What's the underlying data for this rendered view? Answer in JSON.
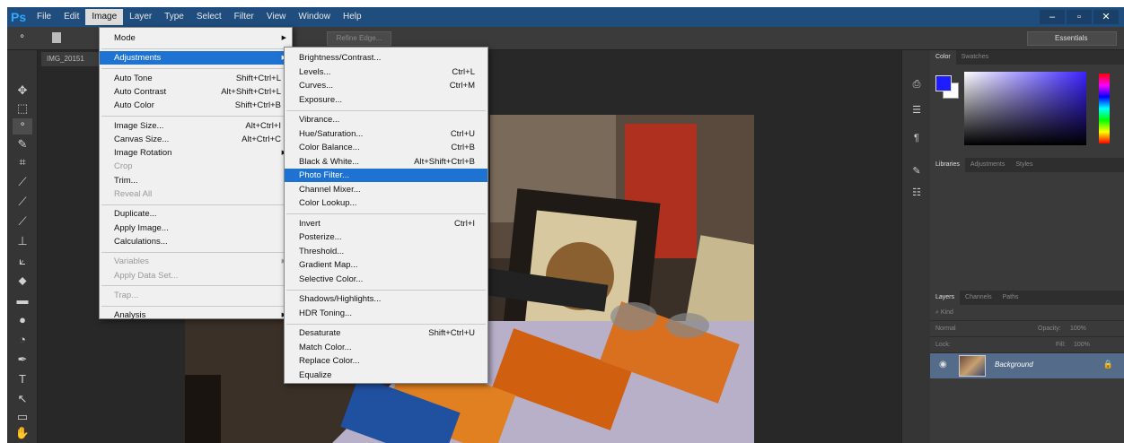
{
  "app": {
    "logo": "Ps",
    "window_controls": [
      "–",
      "▫",
      "✕"
    ]
  },
  "menubar": {
    "items": [
      "File",
      "Edit",
      "Image",
      "Layer",
      "Type",
      "Select",
      "Filter",
      "View",
      "Window",
      "Help"
    ],
    "active": "Image"
  },
  "options": {
    "refine_edge": "Refine Edge...",
    "workspace": "Essentials"
  },
  "document": {
    "tab": "IMG_20151"
  },
  "image_menu": [
    {
      "label": "Mode",
      "submenu": true
    },
    {
      "sep": true
    },
    {
      "label": "Adjustments",
      "submenu": true,
      "highlight": true
    },
    {
      "sep": true
    },
    {
      "label": "Auto Tone",
      "shortcut": "Shift+Ctrl+L"
    },
    {
      "label": "Auto Contrast",
      "shortcut": "Alt+Shift+Ctrl+L"
    },
    {
      "label": "Auto Color",
      "shortcut": "Shift+Ctrl+B"
    },
    {
      "sep": true
    },
    {
      "label": "Image Size...",
      "shortcut": "Alt+Ctrl+I"
    },
    {
      "label": "Canvas Size...",
      "shortcut": "Alt+Ctrl+C"
    },
    {
      "label": "Image Rotation",
      "submenu": true
    },
    {
      "label": "Crop",
      "disabled": true
    },
    {
      "label": "Trim..."
    },
    {
      "label": "Reveal All",
      "disabled": true
    },
    {
      "sep": true
    },
    {
      "label": "Duplicate..."
    },
    {
      "label": "Apply Image..."
    },
    {
      "label": "Calculations..."
    },
    {
      "sep": true
    },
    {
      "label": "Variables",
      "submenu": true,
      "disabled": true
    },
    {
      "label": "Apply Data Set...",
      "disabled": true
    },
    {
      "sep": true
    },
    {
      "label": "Trap...",
      "disabled": true
    },
    {
      "sep": true
    },
    {
      "label": "Analysis",
      "submenu": true
    }
  ],
  "adjustments_menu": [
    {
      "label": "Brightness/Contrast..."
    },
    {
      "label": "Levels...",
      "shortcut": "Ctrl+L"
    },
    {
      "label": "Curves...",
      "shortcut": "Ctrl+M"
    },
    {
      "label": "Exposure..."
    },
    {
      "sep": true
    },
    {
      "label": "Vibrance..."
    },
    {
      "label": "Hue/Saturation...",
      "shortcut": "Ctrl+U"
    },
    {
      "label": "Color Balance...",
      "shortcut": "Ctrl+B"
    },
    {
      "label": "Black & White...",
      "shortcut": "Alt+Shift+Ctrl+B"
    },
    {
      "label": "Photo Filter...",
      "highlight": true
    },
    {
      "label": "Channel Mixer..."
    },
    {
      "label": "Color Lookup..."
    },
    {
      "sep": true
    },
    {
      "label": "Invert",
      "shortcut": "Ctrl+I"
    },
    {
      "label": "Posterize..."
    },
    {
      "label": "Threshold..."
    },
    {
      "label": "Gradient Map..."
    },
    {
      "label": "Selective Color..."
    },
    {
      "sep": true
    },
    {
      "label": "Shadows/Highlights..."
    },
    {
      "label": "HDR Toning..."
    },
    {
      "sep": true
    },
    {
      "label": "Desaturate",
      "shortcut": "Shift+Ctrl+U"
    },
    {
      "label": "Match Color..."
    },
    {
      "label": "Replace Color..."
    },
    {
      "label": "Equalize"
    }
  ],
  "panels": {
    "color_tabs": [
      "Color",
      "Swatches"
    ],
    "library_tabs": [
      "Libraries",
      "Adjustments",
      "Styles"
    ],
    "layer_tabs": [
      "Layers",
      "Channels",
      "Paths"
    ],
    "kind": "Kind",
    "blend_mode": "Normal",
    "opacity_label": "Opacity:",
    "opacity": "100%",
    "lock_label": "Lock:",
    "fill_label": "Fill:",
    "fill": "100%",
    "layer_name": "Background"
  },
  "colors": {
    "menubar": "#1f4d7e",
    "highlight": "#1e73d2",
    "foreground": "#1d1dff",
    "background": "#ffffff"
  }
}
